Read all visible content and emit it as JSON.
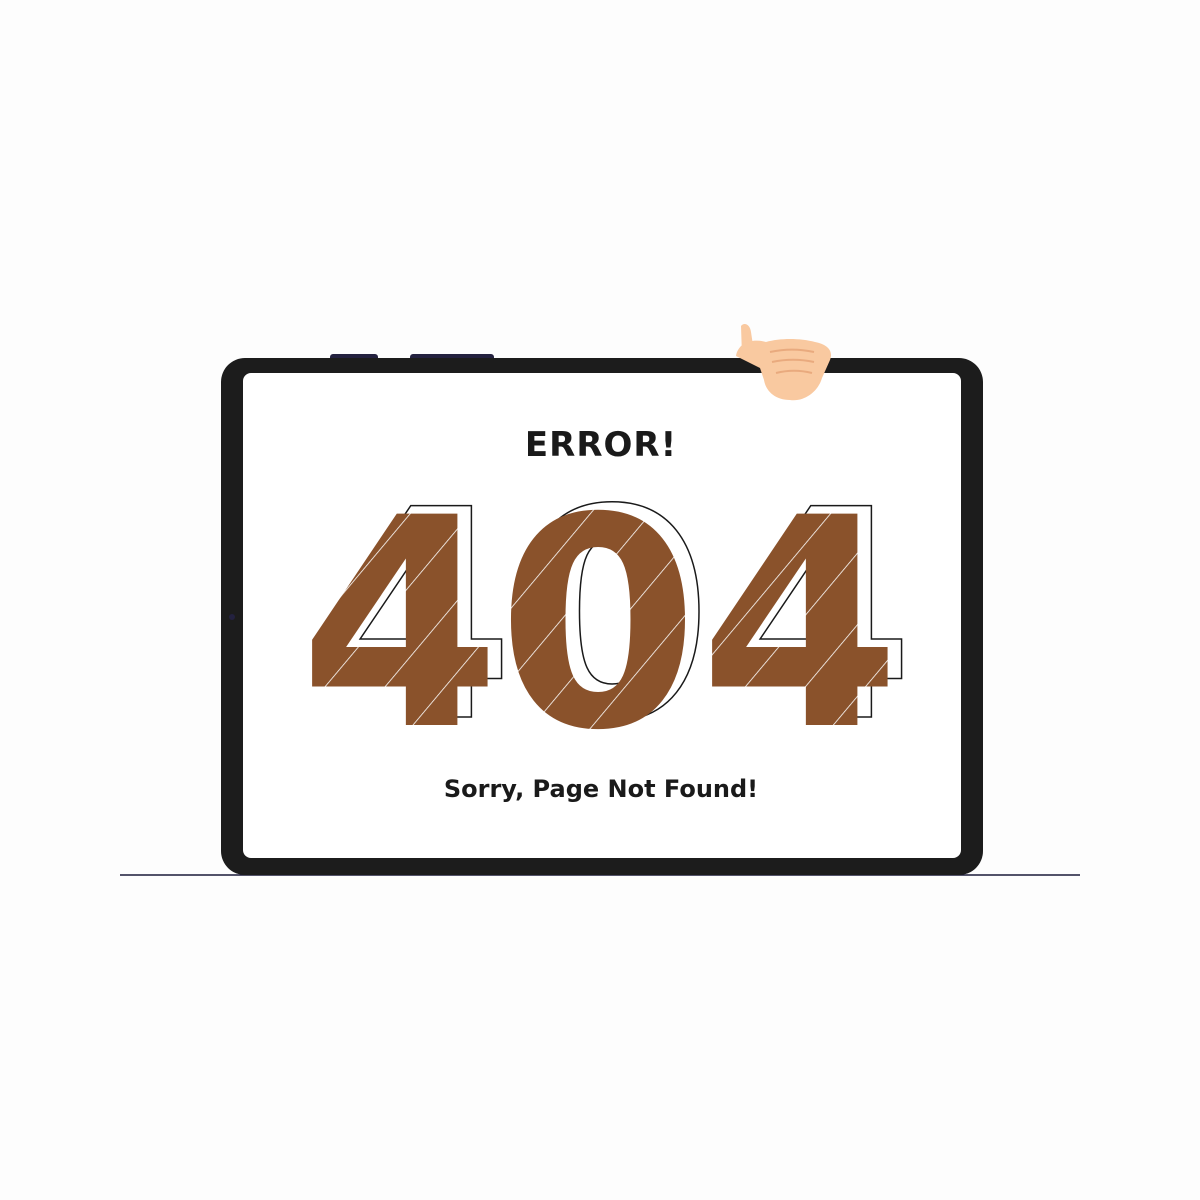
{
  "error_page": {
    "heading": "ERROR!",
    "code": {
      "digit_1": "4",
      "digit_2": "0",
      "digit_3": "4"
    },
    "message": "Sorry, Page Not Found!"
  },
  "colors": {
    "background": "#fdfdfd",
    "tablet_frame": "#1c1c1c",
    "screen": "#ffffff",
    "digit_fill": "#8a522b",
    "digit_stripe": "#ffffff",
    "text": "#1a1a1a",
    "skin": "#f9c9a0",
    "skin_shade": "#e9aa7e",
    "ground_line": "#1b1b3a",
    "buttons": "#23213f"
  },
  "icons": {
    "hand": "hand-icon",
    "tablet": "tablet-icon"
  }
}
